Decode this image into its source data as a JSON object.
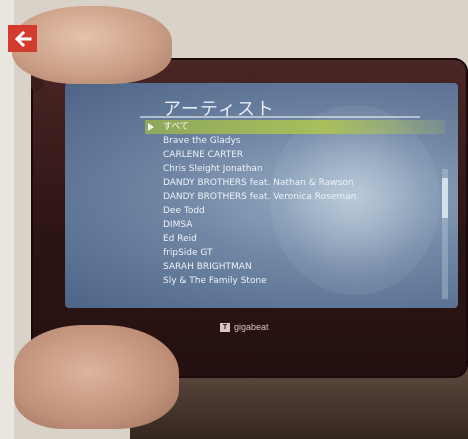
{
  "screen": {
    "title": "アーティスト",
    "artists": [
      "すべて",
      "Brave the Gladys",
      "CARLENE CARTER",
      "Chris Sleight Jonathan",
      "DANDY BROTHERS feat. Nathan & Rawson",
      "DANDY BROTHERS feat. Veronica Roseman",
      "Dee Todd",
      "DIMSA",
      "Ed Reid",
      "fripSide GT",
      "SARAH BRIGHTMAN",
      "Sly & The Family Stone"
    ],
    "selected_index": 0
  },
  "brand": {
    "name": "gigabeat",
    "mark": "T"
  }
}
